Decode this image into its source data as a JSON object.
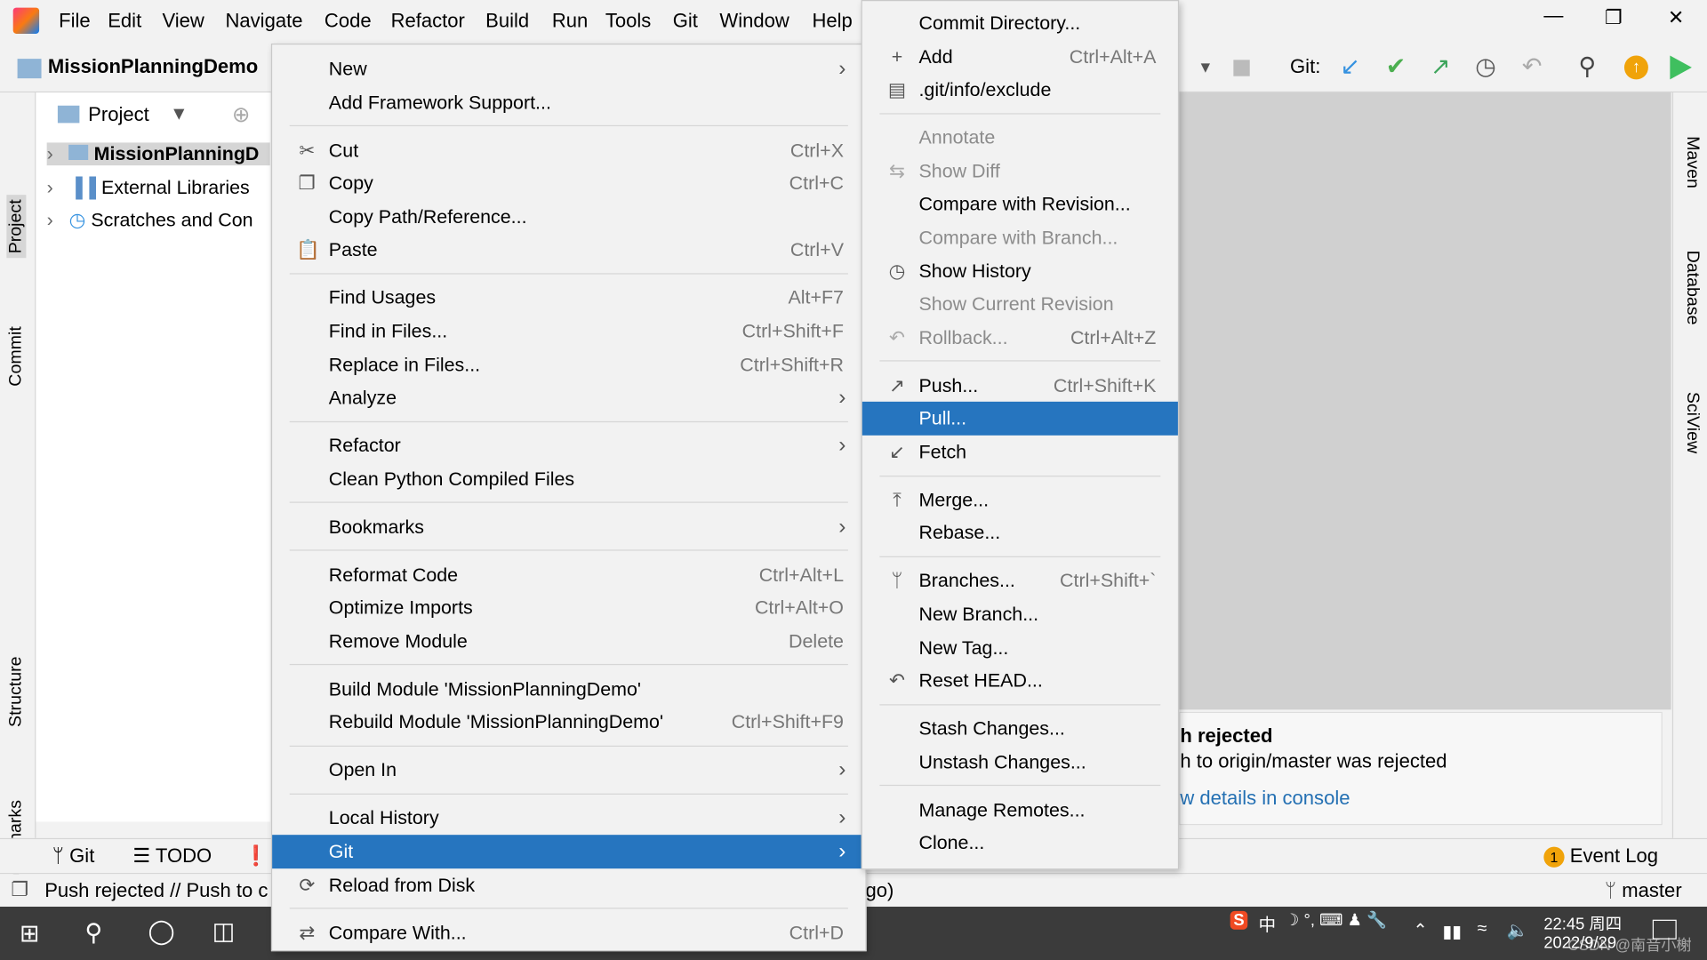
{
  "menubar": {
    "items": [
      "File",
      "Edit",
      "View",
      "Navigate",
      "Code",
      "Refactor",
      "Build",
      "Run",
      "Tools",
      "Git",
      "Window",
      "Help"
    ]
  },
  "window": {
    "controls": [
      "minimize",
      "restore",
      "close"
    ]
  },
  "navbar": {
    "project_name": "MissionPlanningDemo",
    "git_label": "Git:"
  },
  "left_strip": {
    "tabs": [
      "Project",
      "Commit",
      "Structure",
      "Bookmarks"
    ]
  },
  "right_strip": {
    "tabs": [
      "Maven",
      "Database",
      "SciView"
    ]
  },
  "project_panel": {
    "header": "Project",
    "tree": [
      "MissionPlanningD",
      "External Libraries",
      "Scratches and Con"
    ]
  },
  "context_menu": [
    {
      "label": "New",
      "submenu": true
    },
    {
      "label": "Add Framework Support..."
    },
    {
      "sep": true
    },
    {
      "label": "Cut",
      "shortcut": "Ctrl+X",
      "icon": "scissors-icon",
      "glyph": "✂"
    },
    {
      "label": "Copy",
      "shortcut": "Ctrl+C",
      "icon": "copy-icon",
      "glyph": "❐"
    },
    {
      "label": "Copy Path/Reference..."
    },
    {
      "label": "Paste",
      "shortcut": "Ctrl+V",
      "icon": "paste-icon",
      "glyph": "📋"
    },
    {
      "sep": true
    },
    {
      "label": "Find Usages",
      "shortcut": "Alt+F7"
    },
    {
      "label": "Find in Files...",
      "shortcut": "Ctrl+Shift+F"
    },
    {
      "label": "Replace in Files...",
      "shortcut": "Ctrl+Shift+R"
    },
    {
      "label": "Analyze",
      "submenu": true
    },
    {
      "sep": true
    },
    {
      "label": "Refactor",
      "submenu": true
    },
    {
      "label": "Clean Python Compiled Files"
    },
    {
      "sep": true
    },
    {
      "label": "Bookmarks",
      "submenu": true
    },
    {
      "sep": true
    },
    {
      "label": "Reformat Code",
      "shortcut": "Ctrl+Alt+L"
    },
    {
      "label": "Optimize Imports",
      "shortcut": "Ctrl+Alt+O"
    },
    {
      "label": "Remove Module",
      "shortcut": "Delete"
    },
    {
      "sep": true
    },
    {
      "label": "Build Module 'MissionPlanningDemo'"
    },
    {
      "label": "Rebuild Module 'MissionPlanningDemo'",
      "shortcut": "Ctrl+Shift+F9"
    },
    {
      "sep": true
    },
    {
      "label": "Open In",
      "submenu": true
    },
    {
      "sep": true
    },
    {
      "label": "Local History",
      "submenu": true
    },
    {
      "label": "Git",
      "submenu": true,
      "selected": true
    },
    {
      "label": "Reload from Disk",
      "icon": "reload-icon",
      "glyph": "⟳"
    },
    {
      "sep": true
    },
    {
      "label": "Compare With...",
      "shortcut": "Ctrl+D",
      "icon": "compare-icon",
      "glyph": "⇄"
    }
  ],
  "git_submenu": [
    {
      "label": "Commit Directory..."
    },
    {
      "label": "Add",
      "shortcut": "Ctrl+Alt+A",
      "icon": "plus-icon",
      "glyph": "+"
    },
    {
      "label": ".git/info/exclude",
      "icon": "file-ignore-icon",
      "glyph": "▤"
    },
    {
      "sep": true
    },
    {
      "label": "Annotate",
      "disabled": true
    },
    {
      "label": "Show Diff",
      "disabled": true,
      "icon": "diff-icon",
      "glyph": "⇆"
    },
    {
      "label": "Compare with Revision..."
    },
    {
      "label": "Compare with Branch...",
      "disabled": true
    },
    {
      "label": "Show History",
      "icon": "clock-icon",
      "glyph": "◷"
    },
    {
      "label": "Show Current Revision",
      "disabled": true
    },
    {
      "label": "Rollback...",
      "shortcut": "Ctrl+Alt+Z",
      "disabled": true,
      "icon": "undo-icon",
      "glyph": "↶"
    },
    {
      "sep": true
    },
    {
      "label": "Push...",
      "shortcut": "Ctrl+Shift+K",
      "icon": "push-icon",
      "glyph": "↗"
    },
    {
      "label": "Pull...",
      "selected": true
    },
    {
      "label": "Fetch",
      "icon": "fetch-icon",
      "glyph": "↙"
    },
    {
      "sep": true
    },
    {
      "label": "Merge...",
      "icon": "merge-icon",
      "glyph": "⤒"
    },
    {
      "label": "Rebase..."
    },
    {
      "sep": true
    },
    {
      "label": "Branches...",
      "shortcut": "Ctrl+Shift+`",
      "icon": "branch-icon",
      "glyph": "ᛘ"
    },
    {
      "label": "New Branch..."
    },
    {
      "label": "New Tag..."
    },
    {
      "label": "Reset HEAD...",
      "icon": "reset-icon",
      "glyph": "↶"
    },
    {
      "sep": true
    },
    {
      "label": "Stash Changes..."
    },
    {
      "label": "Unstash Changes..."
    },
    {
      "sep": true
    },
    {
      "label": "Manage Remotes..."
    },
    {
      "label": "Clone..."
    }
  ],
  "notification": {
    "title": "h rejected",
    "body": "h to origin/master was rejected",
    "link": "w details in console"
  },
  "toolwindows": {
    "git": "Git",
    "todo": "TODO",
    "event_log": "Event Log",
    "event_count": "1"
  },
  "status": {
    "message": "Push rejected // Push to c",
    "message_tail": "go)",
    "branch": "master"
  },
  "taskbar": {
    "ime": "中",
    "time": "22:45 周四",
    "date": "2022/9/29",
    "watermark": "CSDN @南音小榭"
  },
  "colors": {
    "selection": "#2675bf",
    "git_update": "#3592e0",
    "git_commit": "#4caf50",
    "git_push": "#3da55c",
    "event_badge": "#f0a30a"
  }
}
